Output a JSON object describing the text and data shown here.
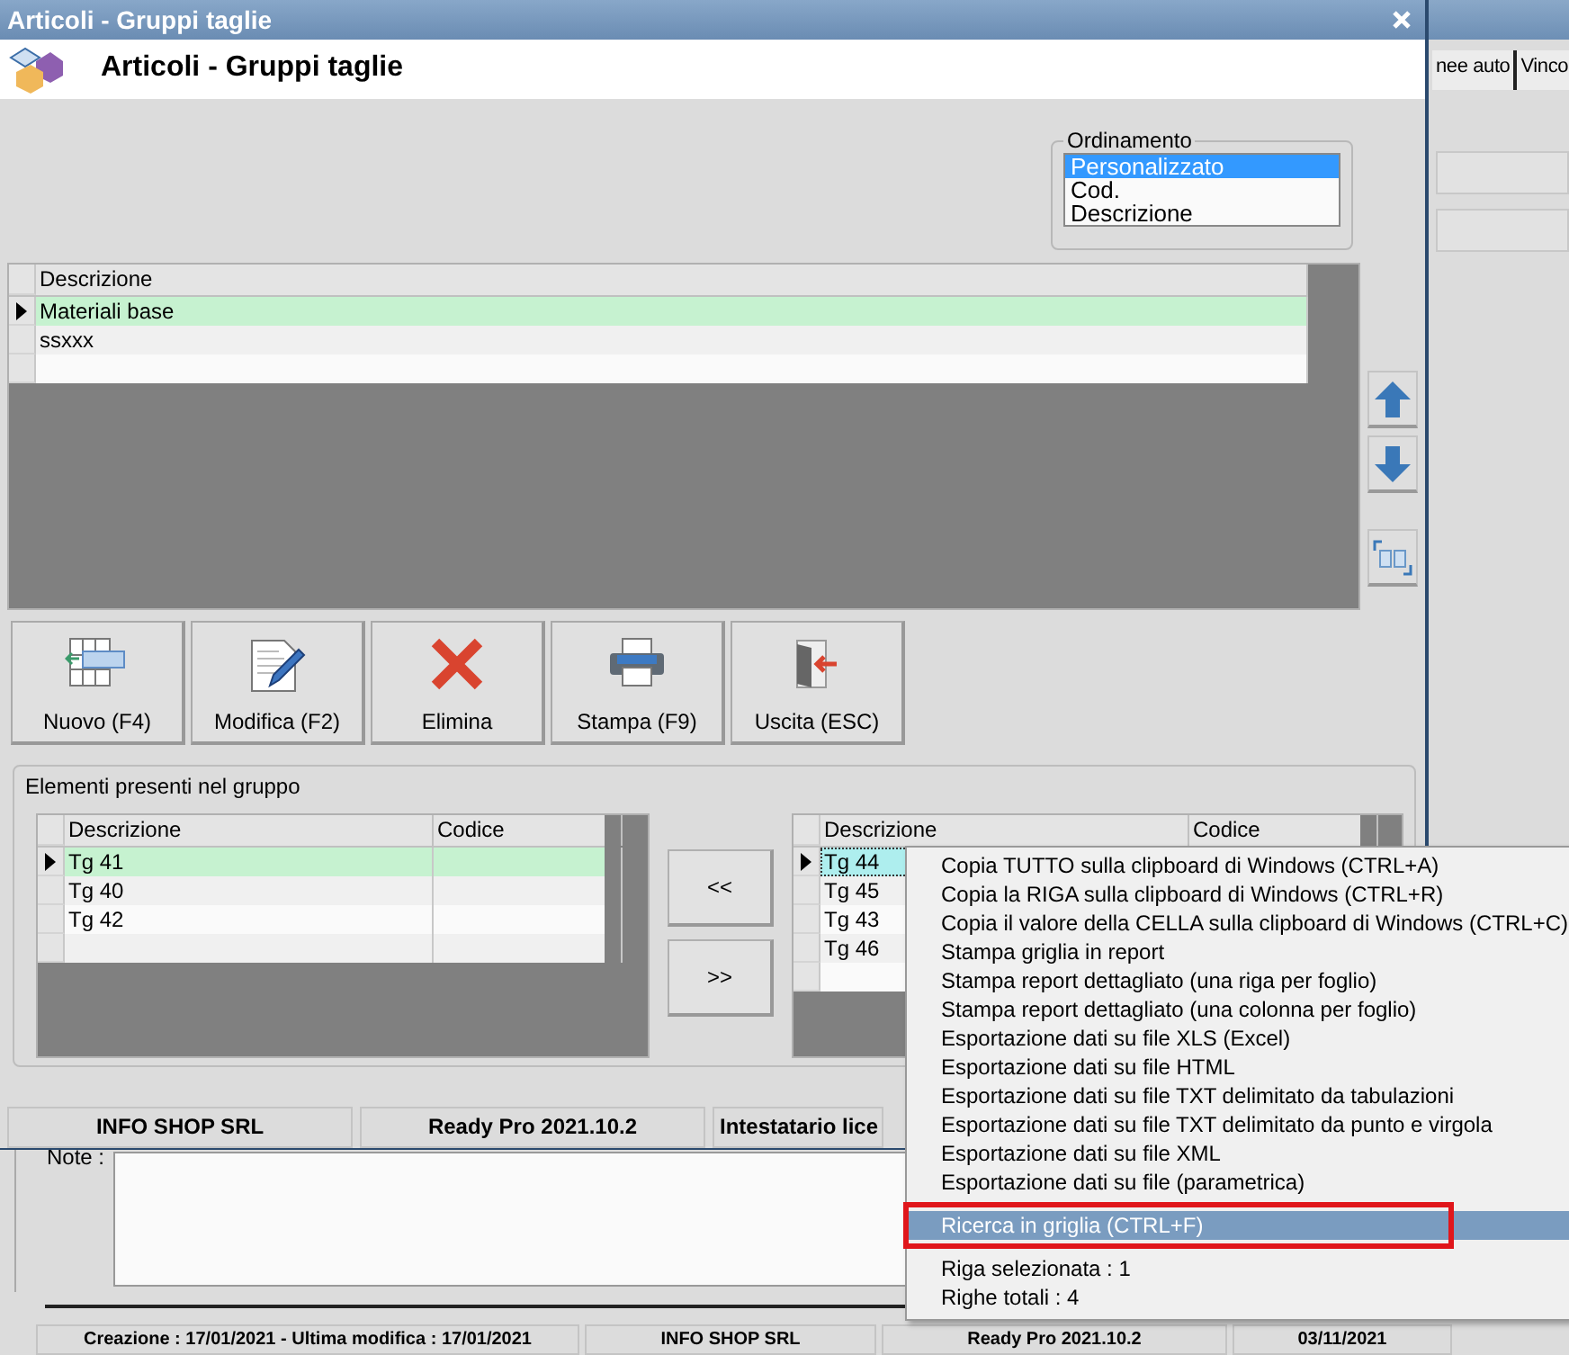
{
  "background_window": {
    "tabs": [
      {
        "label": "nee auto"
      },
      {
        "label": "Vinco"
      }
    ],
    "note_label": "Note :",
    "status_bar": [
      "Creazione : 17/01/2021 - Ultima modifica : 17/01/2021",
      "INFO SHOP SRL",
      "Ready Pro 2021.10.2",
      "03/11/2021"
    ]
  },
  "dialog": {
    "title": "Articoli - Gruppi taglie",
    "header_title": "Articoli - Gruppi taglie",
    "sort": {
      "label": "Ordinamento",
      "options": [
        {
          "label": "Personalizzato",
          "selected": true
        },
        {
          "label": "Cod.",
          "selected": false
        },
        {
          "label": "Descrizione",
          "selected": false
        }
      ]
    },
    "groups_table": {
      "columns": [
        "Descrizione"
      ],
      "rows": [
        {
          "cells": [
            "Materiali base"
          ],
          "selected": true
        },
        {
          "cells": [
            "ssxxx"
          ],
          "selected": false
        }
      ]
    },
    "toolbar": [
      "Nuovo (F4)",
      "Modifica (F2)",
      "Elimina",
      "Stampa (F9)",
      "Uscita (ESC)"
    ],
    "elements": {
      "title": "Elementi presenti nel gruppo",
      "left_table": {
        "columns": [
          "Descrizione",
          "Codice"
        ],
        "rows": [
          {
            "cells": [
              "Tg 41",
              ""
            ],
            "selected": true
          },
          {
            "cells": [
              "Tg 40",
              ""
            ],
            "selected": false
          },
          {
            "cells": [
              "Tg 42",
              ""
            ],
            "selected": false
          }
        ]
      },
      "move_buttons": [
        "<<",
        ">>"
      ],
      "right_table": {
        "columns": [
          "Descrizione",
          "Codice"
        ],
        "rows": [
          {
            "cells": [
              "Tg 44",
              ""
            ],
            "selected": true
          },
          {
            "cells": [
              "Tg 45",
              ""
            ],
            "selected": false
          },
          {
            "cells": [
              "Tg 43",
              ""
            ],
            "selected": false
          },
          {
            "cells": [
              "Tg 46",
              ""
            ],
            "selected": false
          }
        ]
      }
    },
    "status_bar": [
      "INFO SHOP SRL",
      "Ready Pro 2021.10.2",
      "Intestatario lice"
    ]
  },
  "context_menu": {
    "sections": [
      [
        {
          "label": "Copia TUTTO sulla clipboard di Windows (CTRL+A)",
          "selected": false,
          "outlined": false
        },
        {
          "label": "Copia la RIGA sulla clipboard di Windows (CTRL+R)",
          "selected": false,
          "outlined": false
        },
        {
          "label": "Copia il valore della CELLA sulla clipboard di Windows (CTRL+C)",
          "selected": false,
          "outlined": false
        },
        {
          "label": "Stampa griglia in report",
          "selected": false,
          "outlined": false
        },
        {
          "label": "Stampa report dettagliato (una riga per foglio)",
          "selected": false,
          "outlined": false
        },
        {
          "label": "Stampa report dettagliato (una colonna per foglio)",
          "selected": false,
          "outlined": false
        },
        {
          "label": "Esportazione dati su file XLS (Excel)",
          "selected": false,
          "outlined": false
        },
        {
          "label": "Esportazione dati su file HTML",
          "selected": false,
          "outlined": false
        },
        {
          "label": "Esportazione dati su file TXT delimitato da tabulazioni",
          "selected": false,
          "outlined": false
        },
        {
          "label": "Esportazione dati su file TXT delimitato da punto e virgola",
          "selected": false,
          "outlined": false
        },
        {
          "label": "Esportazione dati su file XML",
          "selected": false,
          "outlined": false
        },
        {
          "label": "Esportazione dati su file (parametrica)",
          "selected": false,
          "outlined": false
        }
      ],
      [
        {
          "label": "Ricerca in griglia (CTRL+F)",
          "selected": true,
          "outlined": true
        }
      ],
      [
        {
          "label": "Riga selezionata : 1",
          "selected": false,
          "outlined": false
        },
        {
          "label": "Righe totali : 4",
          "selected": false,
          "outlined": false
        }
      ]
    ]
  }
}
